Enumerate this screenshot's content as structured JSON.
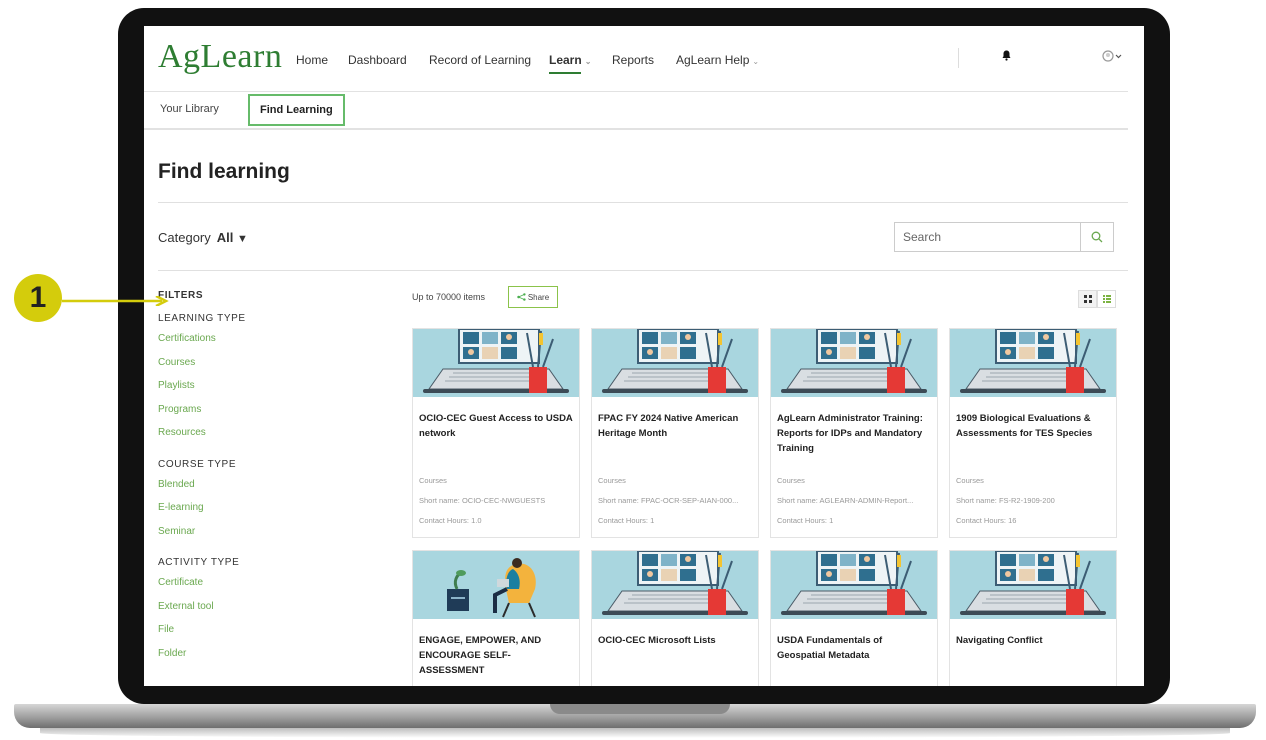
{
  "app": {
    "logo": "AgLearn"
  },
  "nav": {
    "items": [
      {
        "label": "Home"
      },
      {
        "label": "Dashboard"
      },
      {
        "label": "Record of Learning"
      },
      {
        "label": "Learn"
      },
      {
        "label": "Reports"
      },
      {
        "label": "AgLearn Help"
      }
    ],
    "active": "Learn",
    "icons": [
      "bell-icon",
      "user-avatar-icon"
    ]
  },
  "tabs": [
    {
      "label": "Your Library"
    },
    {
      "label": "Find Learning",
      "selected": true
    }
  ],
  "page": {
    "title": "Find learning"
  },
  "category": {
    "label": "Category",
    "value": "All"
  },
  "search": {
    "placeholder": "Search"
  },
  "filters": {
    "title": "FILTERS",
    "groups": [
      {
        "title": "LEARNING TYPE",
        "items": [
          "Certifications",
          "Courses",
          "Playlists",
          "Programs",
          "Resources"
        ]
      },
      {
        "title": "COURSE TYPE",
        "items": [
          "Blended",
          "E-learning",
          "Seminar"
        ]
      },
      {
        "title": "ACTIVITY TYPE",
        "items": [
          "Certificate",
          "External tool",
          "File",
          "Folder"
        ]
      }
    ]
  },
  "results": {
    "count": "Up to 70000 items",
    "share_label": "Share",
    "view": "grid"
  },
  "cards": [
    {
      "title": "OCIO-CEC Guest Access to USDA network",
      "type": "Courses",
      "short": "Short name: OCIO-CEC-NWGUESTS",
      "hours": "Contact Hours: 1.0",
      "image": "video-call"
    },
    {
      "title": "FPAC FY 2024 Native American Heritage Month",
      "type": "Courses",
      "short": "Short name: FPAC-OCR-SEP-AIAN-000...",
      "hours": "Contact Hours: 1",
      "image": "video-call"
    },
    {
      "title": "AgLearn Administrator Training: Reports for IDPs and Mandatory Training",
      "type": "Courses",
      "short": "Short name: AGLEARN-ADMIN-Report...",
      "hours": "Contact Hours: 1",
      "image": "video-call"
    },
    {
      "title": "1909 Biological Evaluations & Assessments for TES Species",
      "type": "Courses",
      "short": "Short name: FS-R2-1909-200",
      "hours": "Contact Hours: 16",
      "image": "video-call"
    },
    {
      "title": "ENGAGE, EMPOWER, AND ENCOURAGE SELF-ASSESSMENT",
      "type": "",
      "short": "",
      "hours": "",
      "image": "person-chair"
    },
    {
      "title": "OCIO-CEC Microsoft Lists",
      "type": "",
      "short": "",
      "hours": "",
      "image": "video-call"
    },
    {
      "title": "USDA Fundamentals of Geospatial Metadata",
      "type": "",
      "short": "",
      "hours": "",
      "image": "video-call"
    },
    {
      "title": "Navigating Conflict",
      "type": "",
      "short": "",
      "hours": "",
      "image": "video-call"
    }
  ],
  "annotation": {
    "number": "1"
  },
  "colors": {
    "brand_green": "#2e7d32",
    "link_green": "#6aa84f",
    "callout": "#d4cc0c",
    "thumb_bg": "#a9d6df"
  }
}
